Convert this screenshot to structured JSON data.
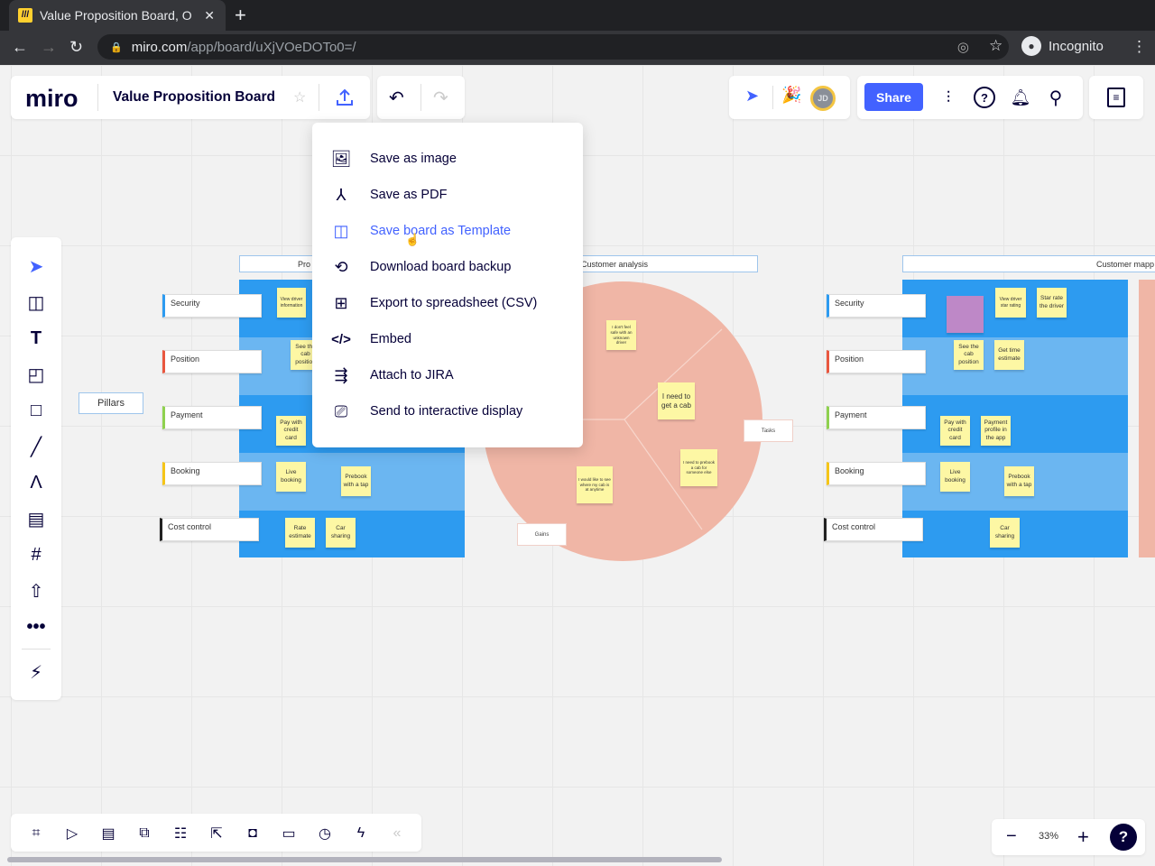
{
  "browser": {
    "tab_title": "Value Proposition Board, O",
    "url_host": "miro.com",
    "url_path": "/app/board/uXjVOeDOTo0=/",
    "profile": "Incognito"
  },
  "app": {
    "logo": "miro",
    "board_title": "Value Proposition Board",
    "share_label": "Share",
    "avatar_initials": "JD",
    "accent": "#4262ff"
  },
  "export_menu": {
    "items": [
      {
        "label": "Save as image",
        "icon": "image-icon"
      },
      {
        "label": "Save as PDF",
        "icon": "pdf-icon"
      },
      {
        "label": "Save board as Template",
        "icon": "template-icon",
        "highlighted": true
      },
      {
        "label": "Download board backup",
        "icon": "backup-icon"
      },
      {
        "label": "Export to spreadsheet (CSV)",
        "icon": "grid-icon"
      },
      {
        "label": "Embed",
        "icon": "code-icon"
      },
      {
        "label": "Attach to JIRA",
        "icon": "jira-icon"
      },
      {
        "label": "Send to interactive display",
        "icon": "display-icon"
      }
    ]
  },
  "board": {
    "pillars": "Pillars",
    "left": {
      "header": "Pro",
      "rows": [
        "Security",
        "Position",
        "Payment",
        "Booking",
        "Cost control"
      ],
      "stickies": [
        "View driver information",
        "See the cab position",
        "Pay with credit card",
        "Live booking",
        "Prebook with a tap",
        "Rate estimate",
        "Car sharing"
      ]
    },
    "analysis": {
      "header": "Customer analysis",
      "tasks": "Tasks",
      "gains": "Gains",
      "stickies": [
        "I don't feel safe with an unknown driver",
        "I need to get a cab",
        "I need to prebook a cab for someone else",
        "I would like to see where my cab is at anytime"
      ]
    },
    "right": {
      "header": "Customer mapp",
      "rows": [
        "Security",
        "Position",
        "Payment",
        "Booking",
        "Cost control"
      ],
      "stickies": [
        "View driver star rating",
        "Star rate the driver",
        "See the cab position",
        "Get time estimate",
        "Pay with credit card",
        "Payment profile in the app",
        "Live booking",
        "Prebook with a tap",
        "Car sharing"
      ]
    }
  },
  "zoom": {
    "level": "33%"
  }
}
